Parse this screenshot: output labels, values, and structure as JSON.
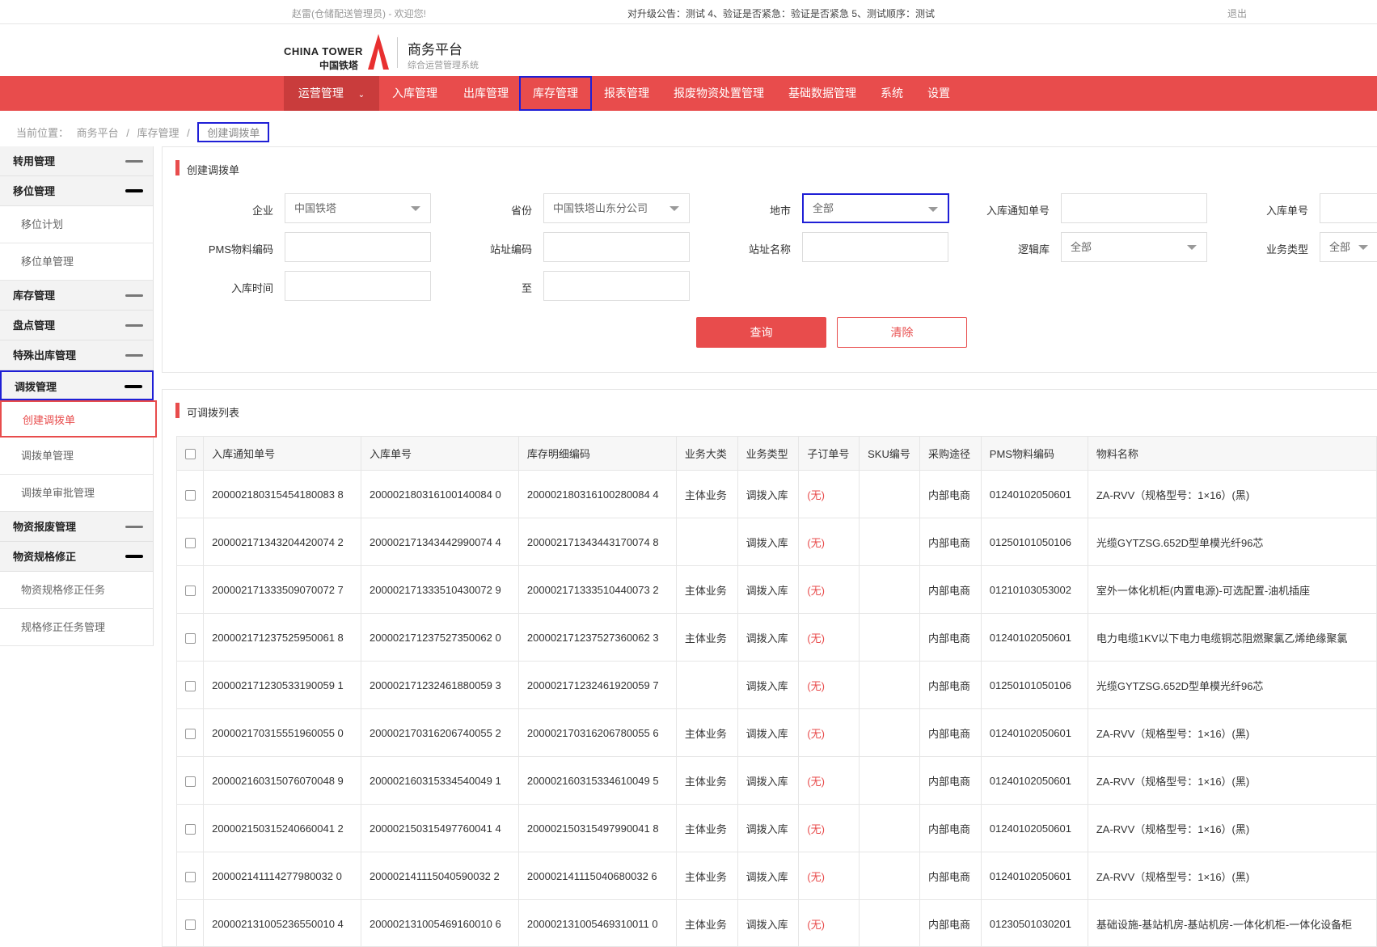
{
  "topbar": {
    "welcome": "赵雷(仓储配送管理员) - 欢迎您!",
    "notice": "对升级公告：测试 4、验证是否紧急：验证是否紧急 5、测试顺序：测试",
    "logout": "退出"
  },
  "logo": {
    "en": "CHINA TOWER",
    "cn": "中国铁塔",
    "title": "商务平台",
    "subtitle": "综合运营管理系统"
  },
  "nav": [
    "运营管理",
    "入库管理",
    "出库管理",
    "库存管理",
    "报表管理",
    "报废物资处置管理",
    "基础数据管理",
    "系统",
    "设置"
  ],
  "breadcrumb": {
    "prefix": "当前位置：",
    "items": [
      "商务平台",
      "/",
      "库存管理",
      "/",
      "创建调拨单"
    ]
  },
  "sidebar": {
    "h0": "转用管理",
    "h1": "移位管理",
    "s1a": "移位计划",
    "s1b": "移位单管理",
    "h2": "库存管理",
    "h3": "盘点管理",
    "h4": "特殊出库管理",
    "h5": "调拨管理",
    "s5a": "创建调拨单",
    "s5b": "调拨单管理",
    "s5c": "调拨单审批管理",
    "h6": "物资报废管理",
    "h7": "物资规格修正",
    "s7a": "物资规格修正任务",
    "s7b": "规格修正任务管理"
  },
  "form": {
    "title": "创建调拨单",
    "company_label": "企业",
    "company_value": "中国铁塔",
    "province_label": "省份",
    "province_value": "中国铁塔山东分公司",
    "city_label": "地市",
    "city_value": "全部",
    "notice_no_label": "入库通知单号",
    "notice_no_value": "",
    "inbound_no_label": "入库单号",
    "inbound_no_value": "",
    "pms_label": "PMS物料编码",
    "pms_value": "",
    "site_code_label": "站址编码",
    "site_code_value": "",
    "site_name_label": "站址名称",
    "site_name_value": "",
    "logic_label": "逻辑库",
    "logic_value": "全部",
    "biz_type_label": "业务类型",
    "biz_type_value": "全部",
    "time_label": "入库时间",
    "time_from": "",
    "to_label": "至",
    "time_to": "",
    "query_btn": "查询",
    "clear_btn": "清除"
  },
  "list": {
    "title": "可调拨列表",
    "columns": [
      "入库通知单号",
      "入库单号",
      "库存明细编码",
      "业务大类",
      "业务类型",
      "子订单号",
      "SKU编号",
      "采购途径",
      "PMS物料编码",
      "物料名称"
    ],
    "rows": [
      [
        "200002180315454180083 8",
        "200002180316100140084 0",
        "200002180316100280084 4",
        "主体业务",
        "调拨入库",
        "(无)",
        "",
        "内部电商",
        "01240102050601",
        "ZA-RVV（规格型号：1×16）(黑)"
      ],
      [
        "200002171343204420074 2",
        "200002171343442990074 4",
        "200002171343443170074 8",
        "",
        "调拨入库",
        "(无)",
        "",
        "内部电商",
        "01250101050106",
        "光缆GYTZSG.652D型单模光纤96芯"
      ],
      [
        "200002171333509070072 7",
        "200002171333510430072 9",
        "200002171333510440073 2",
        "主体业务",
        "调拨入库",
        "(无)",
        "",
        "内部电商",
        "01210103053002",
        "室外一体化机柜(内置电源)-可选配置-油机插座"
      ],
      [
        "200002171237525950061 8",
        "200002171237527350062 0",
        "200002171237527360062 3",
        "主体业务",
        "调拨入库",
        "(无)",
        "",
        "内部电商",
        "01240102050601",
        "电力电缆1KV以下电力电缆铜芯阻燃聚氯乙烯绝缘聚氯"
      ],
      [
        "200002171230533190059 1",
        "200002171232461880059 3",
        "200002171232461920059 7",
        "",
        "调拨入库",
        "(无)",
        "",
        "内部电商",
        "01250101050106",
        "光缆GYTZSG.652D型单模光纤96芯"
      ],
      [
        "200002170315551960055 0",
        "200002170316206740055 2",
        "200002170316206780055 6",
        "主体业务",
        "调拨入库",
        "(无)",
        "",
        "内部电商",
        "01240102050601",
        "ZA-RVV（规格型号：1×16）(黑)"
      ],
      [
        "200002160315076070048 9",
        "200002160315334540049 1",
        "200002160315334610049 5",
        "主体业务",
        "调拨入库",
        "(无)",
        "",
        "内部电商",
        "01240102050601",
        "ZA-RVV（规格型号：1×16）(黑)"
      ],
      [
        "200002150315240660041 2",
        "200002150315497760041 4",
        "200002150315497990041 8",
        "主体业务",
        "调拨入库",
        "(无)",
        "",
        "内部电商",
        "01240102050601",
        "ZA-RVV（规格型号：1×16）(黑)"
      ],
      [
        "200002141114277980032 0",
        "200002141115040590032 2",
        "200002141115040680032 6",
        "主体业务",
        "调拨入库",
        "(无)",
        "",
        "内部电商",
        "01240102050601",
        "ZA-RVV（规格型号：1×16）(黑)"
      ],
      [
        "200002131005236550010 4",
        "200002131005469160010 6",
        "200002131005469310011 0",
        "主体业务",
        "调拨入库",
        "(无)",
        "",
        "内部电商",
        "01230501030201",
        "基础设施-基站机房-基站机房-一体化机柜-一体化设备柜"
      ]
    ]
  },
  "colors": {
    "brand_red": "#e84c4c",
    "highlight_blue": "#1f1fd6"
  }
}
